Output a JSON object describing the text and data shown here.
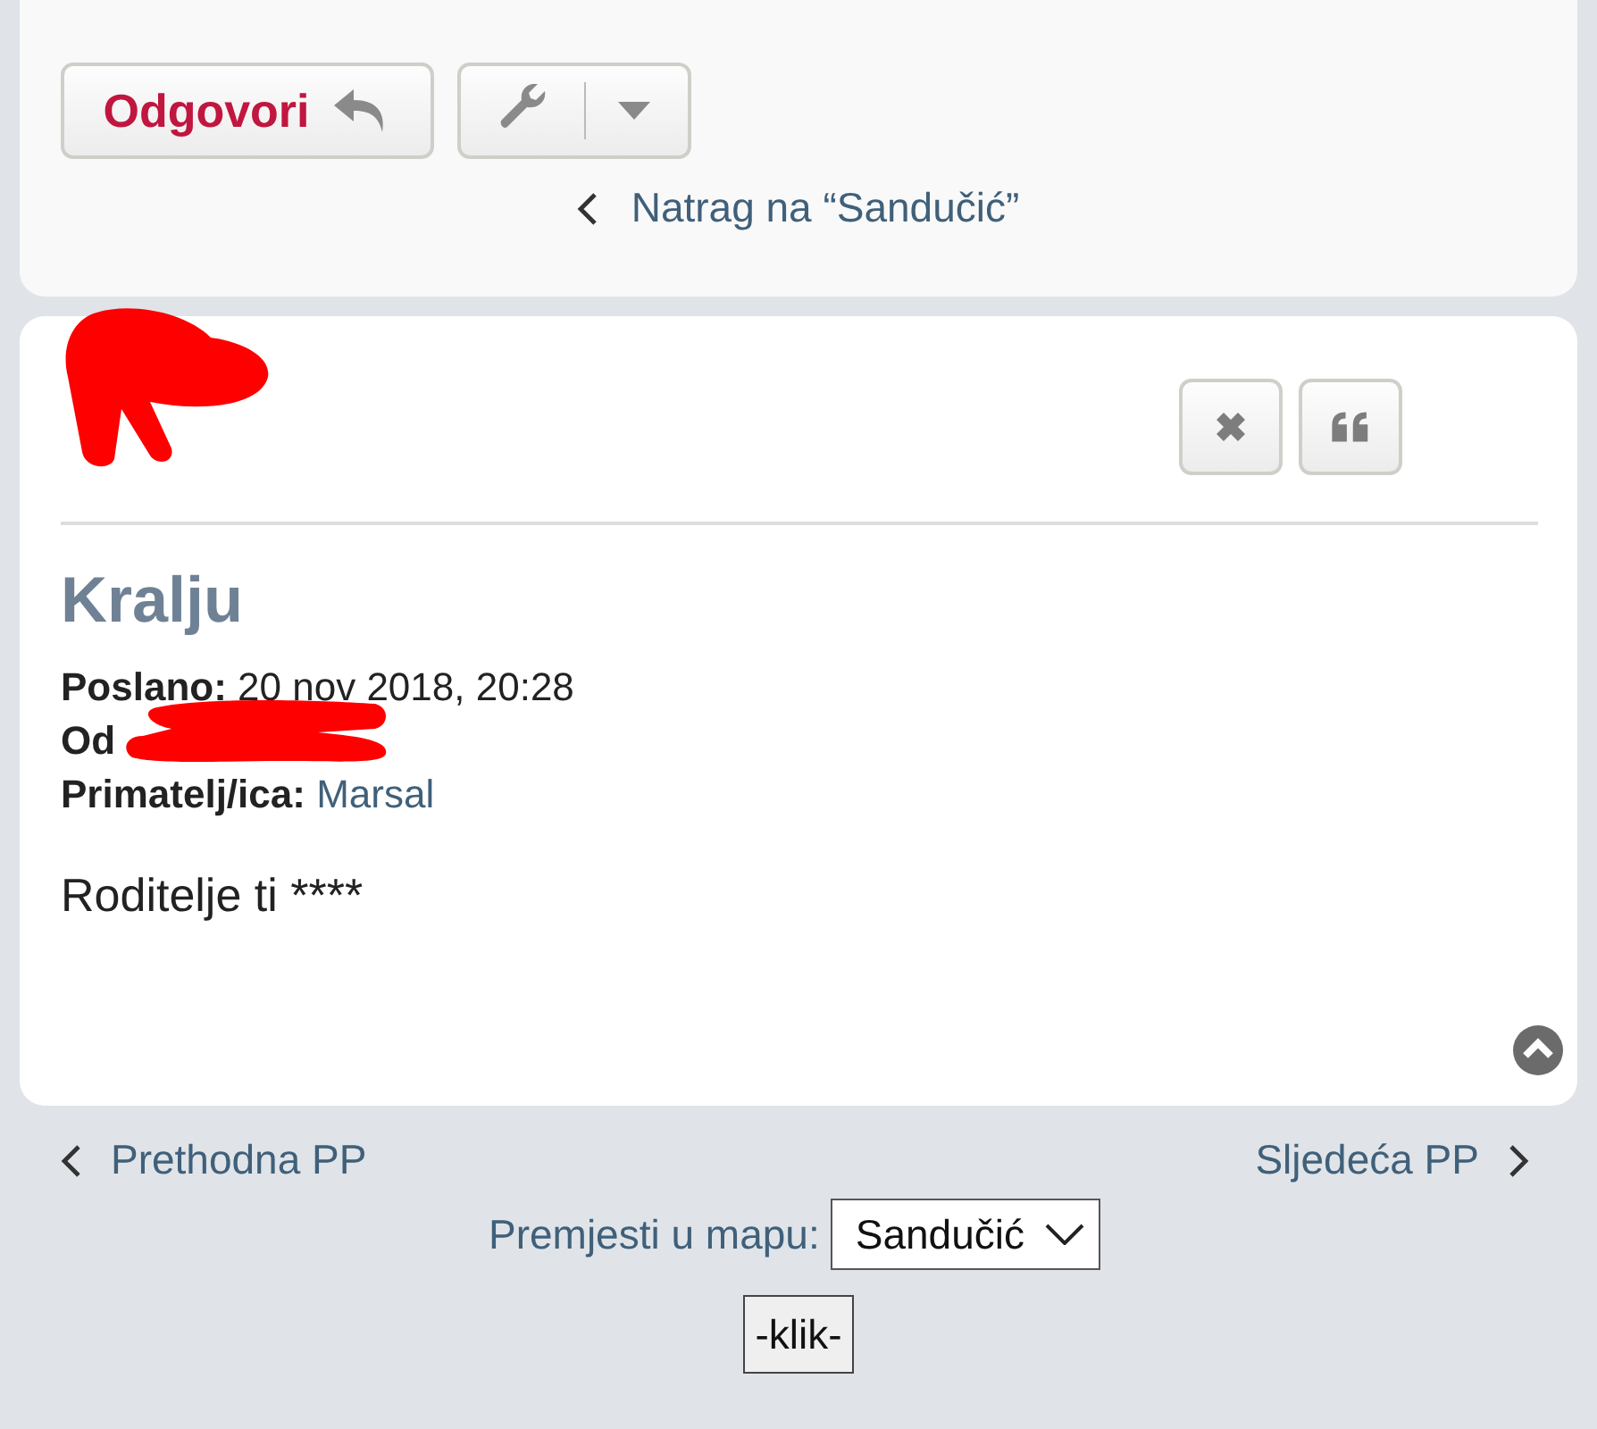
{
  "post_actions": {
    "reply_button": {
      "label": "Odgovori"
    },
    "tools_button": {
      "has_dropdown": true
    }
  },
  "back_link": {
    "label": "Natrag na “Sandučić”"
  },
  "message": {
    "author": {
      "redacted": true
    },
    "buttons": [
      {
        "kind": "delete"
      },
      {
        "kind": "quote"
      }
    ],
    "subject": "Kralju",
    "details": [
      {
        "label": "Poslano:",
        "value": "20 nov 2018, 20:28",
        "kind": "text",
        "redacted": false
      },
      {
        "label": "Od",
        "redacted": true
      },
      {
        "label": "Primatelj/ica:",
        "value": "Marsal",
        "kind": "link",
        "redacted": false
      }
    ],
    "body": "Roditelje ti ****"
  },
  "pager": {
    "previous": "Prethodna PP",
    "next": "Sljedeća PP"
  },
  "move": {
    "label": "Premjesti u mapu:",
    "folder": "Sandučić",
    "button": "-klik-"
  }
}
